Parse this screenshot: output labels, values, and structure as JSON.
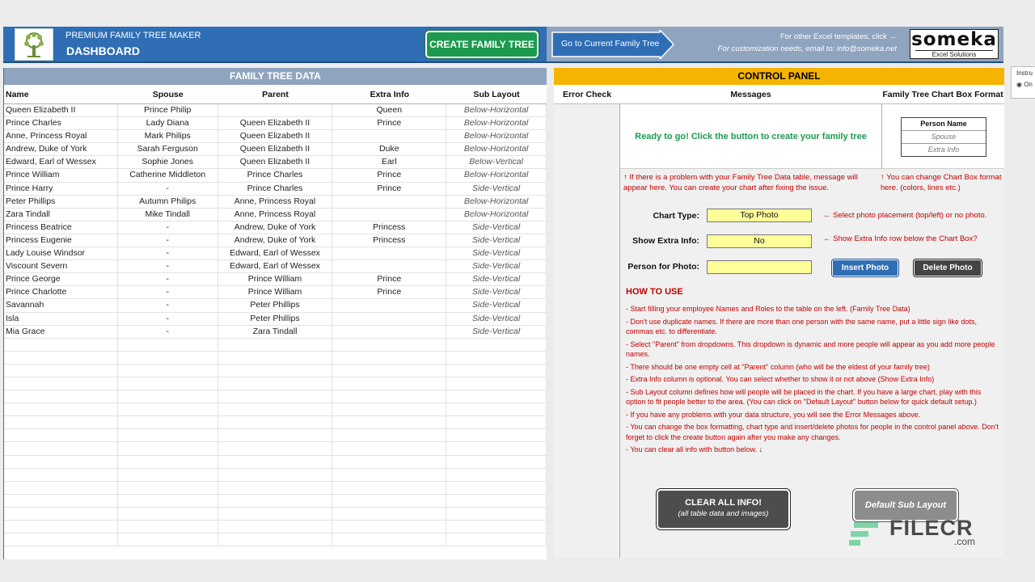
{
  "header": {
    "subtitle": "PREMIUM FAMILY TREE MAKER",
    "title": "DASHBOARD",
    "create_button": "CREATE FAMILY TREE",
    "goto_button": "Go to Current Family Tree",
    "note_templates": "For other Excel templates, click →",
    "note_customization": "For customization needs, email to: info@someka.net",
    "brand": "someka",
    "brand_tagline": "Excel Solutions",
    "instr_label": "Instru",
    "instr_option": "On"
  },
  "left_table": {
    "title": "FAMILY TREE DATA",
    "columns": [
      "Name",
      "Spouse",
      "Parent",
      "Extra Info",
      "Sub Layout"
    ],
    "rows": [
      [
        "Queen Elizabeth II",
        "Prince Philip",
        "",
        "Queen",
        "Below-Horizontal"
      ],
      [
        "Prince Charles",
        "Lady Diana",
        "Queen Elizabeth II",
        "Prince",
        "Below-Horizontal"
      ],
      [
        "Anne, Princess Royal",
        "Mark Philips",
        "Queen Elizabeth II",
        "",
        "Below-Horizontal"
      ],
      [
        "Andrew, Duke of York",
        "Sarah Ferguson",
        "Queen Elizabeth II",
        "Duke",
        "Below-Horizontal"
      ],
      [
        "Edward, Earl of Wessex",
        "Sophie Jones",
        "Queen Elizabeth II",
        "Earl",
        "Below-Vertical"
      ],
      [
        "Prince William",
        "Catherine Middleton",
        "Prince Charles",
        "Prince",
        "Below-Horizontal"
      ],
      [
        "Prince Harry",
        "-",
        "Prince Charles",
        "Prince",
        "Side-Vertical"
      ],
      [
        "Peter Phillips",
        "Autumn Philips",
        "Anne, Princess Royal",
        "",
        "Below-Horizontal"
      ],
      [
        "Zara Tindall",
        "Mike Tindall",
        "Anne, Princess Royal",
        "",
        "Below-Horizontal"
      ],
      [
        "Princess Beatrice",
        "-",
        "Andrew, Duke of York",
        "Princess",
        "Side-Vertical"
      ],
      [
        "Princess Eugenie",
        "-",
        "Andrew, Duke of York",
        "Princess",
        "Side-Vertical"
      ],
      [
        "Lady Louise Windsor",
        "-",
        "Edward, Earl of Wessex",
        "",
        "Side-Vertical"
      ],
      [
        "Viscount Severn",
        "-",
        "Edward, Earl of Wessex",
        "",
        "Side-Vertical"
      ],
      [
        "Prince George",
        "-",
        "Prince William",
        "Prince",
        "Side-Vertical"
      ],
      [
        "Prince Charlotte",
        "-",
        "Prince William",
        "Prince",
        "Side-Vertical"
      ],
      [
        "Savannah",
        "-",
        "Peter Phillips",
        "",
        "Side-Vertical"
      ],
      [
        "Isla",
        "-",
        "Peter Phillips",
        "",
        "Side-Vertical"
      ],
      [
        "Mia Grace",
        "-",
        "Zara Tindall",
        "",
        "Side-Vertical"
      ]
    ]
  },
  "control_panel": {
    "title": "CONTROL PANEL",
    "col_error": "Error Check",
    "col_messages": "Messages",
    "col_format": "Family Tree Chart Box Format",
    "message": "Ready to go! Click the button to create your family tree",
    "format_box": {
      "name": "Person Name",
      "spouse": "Spouse",
      "extra": "Extra Info"
    },
    "note_messages": "↑ If there is a problem with your Family Tree Data table, message will appear here. You can create your chart after fixing the issue.",
    "note_format": "↑ You can change Chart Box format here. (colors, lines etc.)",
    "chart_type_label": "Chart Type:",
    "chart_type_value": "Top Photo",
    "chart_type_hint": "← Select photo placement (top/left) or no photo.",
    "extra_info_label": "Show Extra Info:",
    "extra_info_value": "No",
    "extra_info_hint": "← Show Extra Info row below the Chart Box?",
    "photo_label": "Person for Photo:",
    "photo_value": "",
    "insert_button": "Insert Photo",
    "delete_button": "Delete Photo",
    "howto_title": "HOW TO USE",
    "howto": [
      "- Start filling your employee Names and Roles to the table on the left. (Family Tree Data)",
      "- Don't use duplicate names. If there are more than one person with the same name, put a little sign like dots, commas etc. to differentiate.",
      "- Select \"Parent\" from dropdowns. This dropdown is dynamic and more people will appear as you add more people names.",
      "- There should be one empty cell at \"Parent\" column (who will be the eldest of your family tree)",
      "- Extra Info column is optional. You can select whether to show it or not above (Show Extra Info)",
      "- Sub Layout column defines how will people will be placed in the chart. If you have a large chart, play with this option to fit people better to the area. (You can click on \"Default Layout\" button below for quick default setup.)",
      "- If you have any problems with your data structure, you will see the Error Messages above.",
      "- You can change the box formatting, chart type and insert/delete photos for people in the control panel above. Don't forget to click the create button again after you make any changes.",
      "- You can clear all info with button below. ↓"
    ],
    "clear_button": "CLEAR ALL INFO!",
    "clear_button_sub": "(all table data and images)",
    "default_button": "Default Sub Layout"
  },
  "watermark": {
    "text": "FILECR",
    "suffix": ".com"
  },
  "colors": {
    "header_blue": "#2f6eb5",
    "green": "#1d9a4f",
    "panel_yellow": "#f5b400",
    "input_yellow": "#ffff99",
    "note_red": "#c00000"
  }
}
